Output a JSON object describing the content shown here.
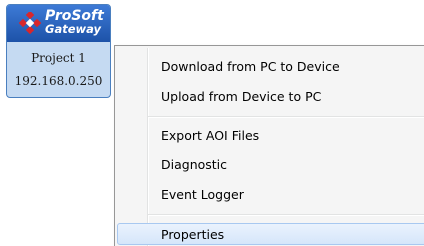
{
  "device": {
    "brand_line1": "ProSoft",
    "brand_line2": "Gateway",
    "name": "Project 1",
    "ip": "192.168.0.250"
  },
  "context_menu": {
    "download_label": "Download from PC to Device",
    "upload_label": "Upload from Device to PC",
    "export_aoi_label": "Export AOI Files",
    "diagnostic_label": "Diagnostic",
    "event_logger_label": "Event Logger",
    "properties_label": "Properties"
  },
  "colors": {
    "header_blue": "#2a63bd",
    "tile_background": "#c5daf2",
    "logo_red": "#d9262b",
    "menu_background": "#f5f5f5",
    "menu_hover": "#d5e6fa"
  }
}
